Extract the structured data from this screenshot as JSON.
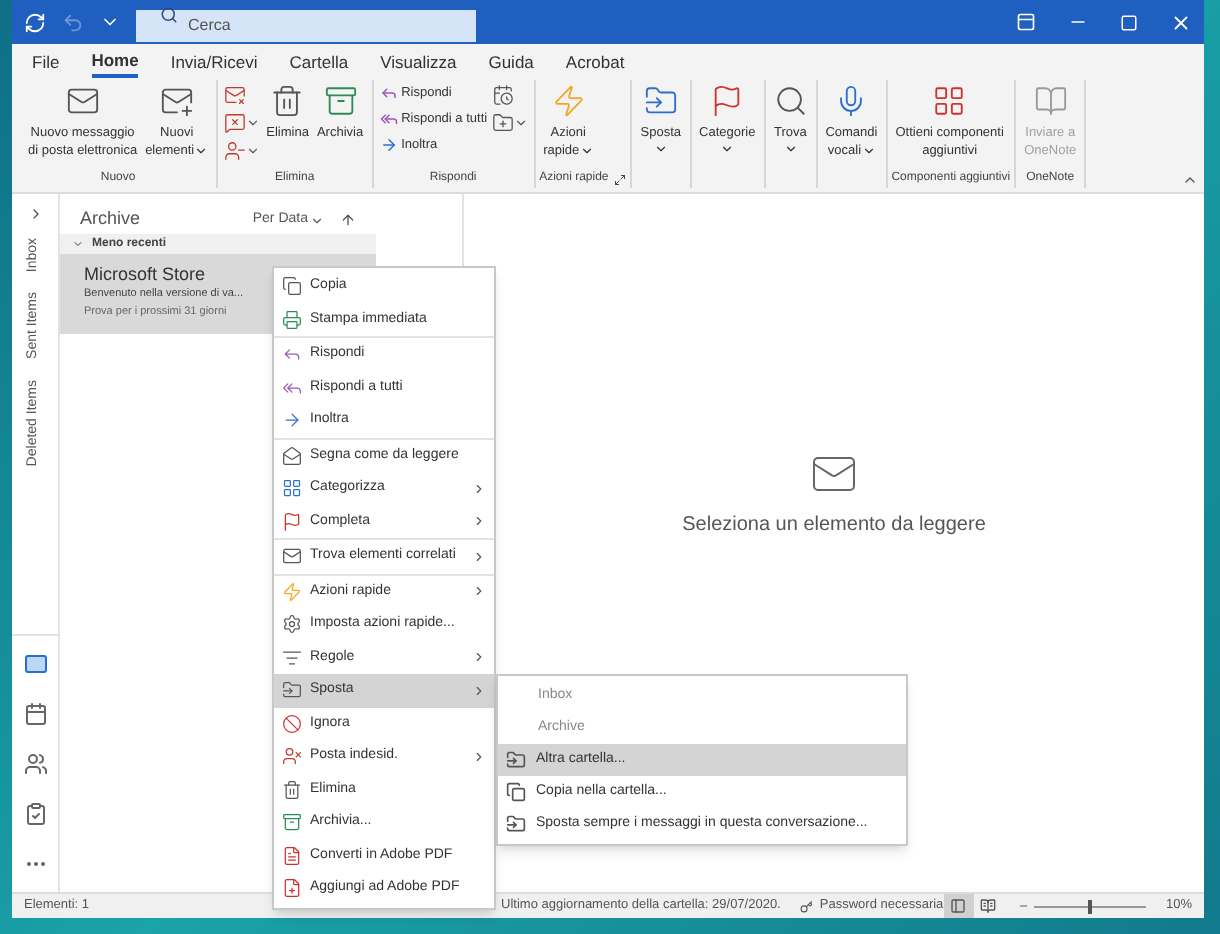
{
  "window": {
    "search": {
      "placeholder": "Cerca"
    }
  },
  "menu_tabs": [
    {
      "label": "File",
      "selected": false
    },
    {
      "label": "Home",
      "selected": true
    },
    {
      "label": "Invia/Ricevi",
      "selected": false
    },
    {
      "label": "Cartella",
      "selected": false
    },
    {
      "label": "Visualizza",
      "selected": false
    },
    {
      "label": "Guida",
      "selected": false
    },
    {
      "label": "Acrobat",
      "selected": false
    }
  ],
  "ribbon": [
    {
      "label": "Nuovo",
      "columns": [
        [
          {
            "kind": "large",
            "lines": [
              "Nuovo messaggio",
              "di posta elettronica"
            ]
          }
        ],
        [
          {
            "kind": "large",
            "lines": [
              "Nuovi",
              "elementi"
            ],
            "caret": true
          }
        ]
      ]
    },
    {
      "label": "Elimina",
      "columns": [
        [
          {
            "kind": "icon"
          },
          {
            "kind": "icon",
            "caret": true
          },
          {
            "kind": "icon",
            "caret": true
          }
        ],
        [
          {
            "kind": "large",
            "lines": [
              "Elimina"
            ]
          }
        ],
        [
          {
            "kind": "large",
            "lines": [
              "Archivia"
            ]
          }
        ]
      ]
    },
    {
      "label": "Rispondi",
      "columns": [
        [
          {
            "kind": "small",
            "lines": [
              "Rispondi"
            ]
          },
          {
            "kind": "small",
            "lines": [
              "Rispondi a tutti"
            ]
          },
          {
            "kind": "small",
            "lines": [
              "Inoltra"
            ]
          }
        ],
        [
          {
            "kind": "icon"
          },
          {
            "kind": "icon",
            "caret": true
          }
        ]
      ]
    },
    {
      "label": "Azioni rapide",
      "launcher": true,
      "columns": [
        [
          {
            "kind": "large",
            "lines": [
              "Azioni",
              "rapide"
            ],
            "caret": true
          }
        ]
      ]
    },
    {
      "columns": [
        [
          {
            "kind": "large",
            "lines": [
              "Sposta"
            ],
            "caret": true
          }
        ]
      ]
    },
    {
      "columns": [
        [
          {
            "kind": "large",
            "lines": [
              "Categorie"
            ],
            "caret": true
          }
        ]
      ]
    },
    {
      "columns": [
        [
          {
            "kind": "large",
            "lines": [
              "Trova"
            ],
            "caret": true
          }
        ]
      ]
    },
    {
      "columns": [
        [
          {
            "kind": "large",
            "lines": [
              "Comandi",
              "vocali"
            ],
            "caret": true
          }
        ]
      ]
    },
    {
      "label": "Componenti aggiuntivi",
      "columns": [
        [
          {
            "kind": "large",
            "lines": [
              "Ottieni componenti",
              "aggiuntivi"
            ]
          }
        ]
      ]
    },
    {
      "label": "OneNote",
      "columns": [
        [
          {
            "kind": "large",
            "lines": [
              "Inviare a",
              "OneNote"
            ],
            "disabled": true
          }
        ]
      ]
    }
  ],
  "folder_tabs": [
    {
      "label": "Inbox"
    },
    {
      "label": "Sent Items"
    },
    {
      "label": "Deleted Items"
    }
  ],
  "modules": [
    {
      "selected": true
    },
    {
      "selected": false
    },
    {
      "selected": false
    },
    {
      "selected": false
    },
    {
      "selected": false
    }
  ],
  "message_list": {
    "folder": "Archive",
    "sort": "Per Data",
    "groups": [
      {
        "label": "Meno recenti",
        "expanded": true,
        "messages": [
          {
            "sender": "Microsoft Store",
            "subject": "Benvenuto nella versione di va...",
            "preview": "Prova per i prossimi 31 giorni",
            "selected": true
          }
        ]
      }
    ]
  },
  "reading_pane": {
    "message": "Seleziona un elemento da leggere"
  },
  "context_menu": [
    [
      {
        "label": "Copia",
        "submenu": false,
        "selected": false
      },
      {
        "label": "Stampa immediata",
        "submenu": false,
        "selected": false
      }
    ],
    [
      {
        "label": "Rispondi",
        "submenu": false,
        "selected": false
      },
      {
        "label": "Rispondi a tutti",
        "submenu": false,
        "selected": false
      },
      {
        "label": "Inoltra",
        "submenu": false,
        "selected": false
      }
    ],
    [
      {
        "label": "Segna come da leggere",
        "submenu": false,
        "selected": false
      },
      {
        "label": "Categorizza",
        "submenu": true,
        "selected": false
      },
      {
        "label": "Completa",
        "submenu": true,
        "selected": false
      }
    ],
    [
      {
        "label": "Trova elementi correlati",
        "submenu": true,
        "selected": false
      }
    ],
    [
      {
        "label": "Azioni rapide",
        "submenu": true,
        "selected": false
      },
      {
        "label": "Imposta azioni rapide...",
        "submenu": false,
        "selected": false
      },
      {
        "label": "Regole",
        "submenu": true,
        "selected": false
      },
      {
        "label": "Sposta",
        "submenu": true,
        "selected": true
      },
      {
        "label": "Ignora",
        "submenu": false,
        "selected": false
      },
      {
        "label": "Posta indesid.",
        "submenu": true,
        "selected": false
      },
      {
        "label": "Elimina",
        "submenu": false,
        "selected": false
      },
      {
        "label": "Archivia...",
        "submenu": false,
        "selected": false
      },
      {
        "label": "Converti in Adobe PDF",
        "submenu": false,
        "selected": false
      },
      {
        "label": "Aggiungi ad Adobe PDF",
        "submenu": false,
        "selected": false
      }
    ]
  ],
  "submenu": [
    {
      "kind": "folder",
      "label": "Inbox",
      "selected": false
    },
    {
      "kind": "folder",
      "label": "Archive",
      "selected": false
    },
    {
      "kind": "command",
      "label": "Altra cartella...",
      "selected": true
    },
    {
      "kind": "command",
      "label": "Copia nella cartella...",
      "selected": false
    },
    {
      "kind": "command",
      "label": "Sposta sempre i messaggi in questa conversazione...",
      "selected": false
    }
  ],
  "status_bar": {
    "items": "Elementi: 1",
    "last_update": "Ultimo aggiornamento della cartella: 29/07/2020.",
    "password": "Password necessaria",
    "views": [
      {
        "selected": true
      },
      {
        "selected": false
      }
    ],
    "zoom_slider": {
      "level": 0.5
    },
    "zoom": "10%"
  }
}
